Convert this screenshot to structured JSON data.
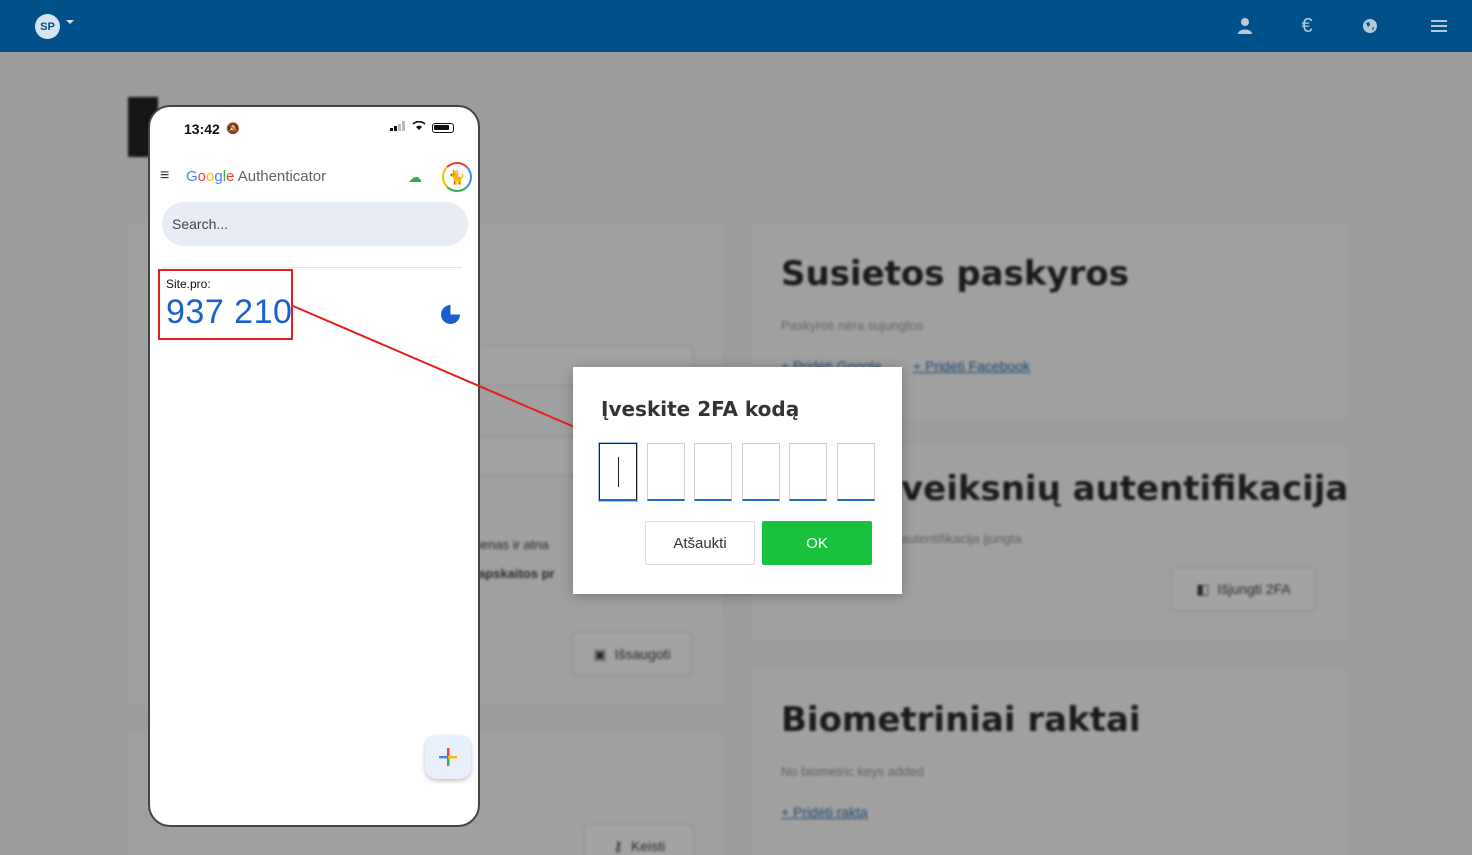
{
  "topbar": {
    "logo": "SP",
    "icons": [
      "user-icon",
      "euro-icon",
      "globe-icon",
      "menu-icon"
    ],
    "euro_glyph": "€"
  },
  "background": {
    "linked_accounts": {
      "title": "Susietos paskyros",
      "status": "Paskyros nėra sujungtos",
      "link_google": "+ Pridėti Google",
      "link_facebook": "+ Pridėti Facebook"
    },
    "two_factor": {
      "title": "veiksnių autentifikacija",
      "status": "autentifikacija įjungta",
      "disable_button": "Išjungti 2FA"
    },
    "biometric": {
      "title": "Biometriniai raktai",
      "status": "No biometric keys added",
      "add_link": "+ Pridėti raktą"
    },
    "left_partial_text_1": "ienas ir atna",
    "left_partial_text_2": "apskaitos pr",
    "save_button": "Išsaugoti",
    "change_button": "Keisti"
  },
  "phone": {
    "time": "13:42",
    "app_name_brand": [
      "G",
      "o",
      "o",
      "g",
      "l",
      "e"
    ],
    "app_name_rest": " Authenticator",
    "search_placeholder": "Search...",
    "entry_label": "Site.pro:",
    "entry_code": "937 210"
  },
  "modal": {
    "title": "Įveskite 2FA kodą",
    "digits": [
      "",
      "",
      "",
      "",
      "",
      ""
    ],
    "cancel_label": "Atšaukti",
    "ok_label": "OK"
  },
  "colors": {
    "topbar": "#00508a",
    "ok_button": "#19c23c",
    "annotation": "#e02020",
    "code": "#1a5fd0"
  }
}
